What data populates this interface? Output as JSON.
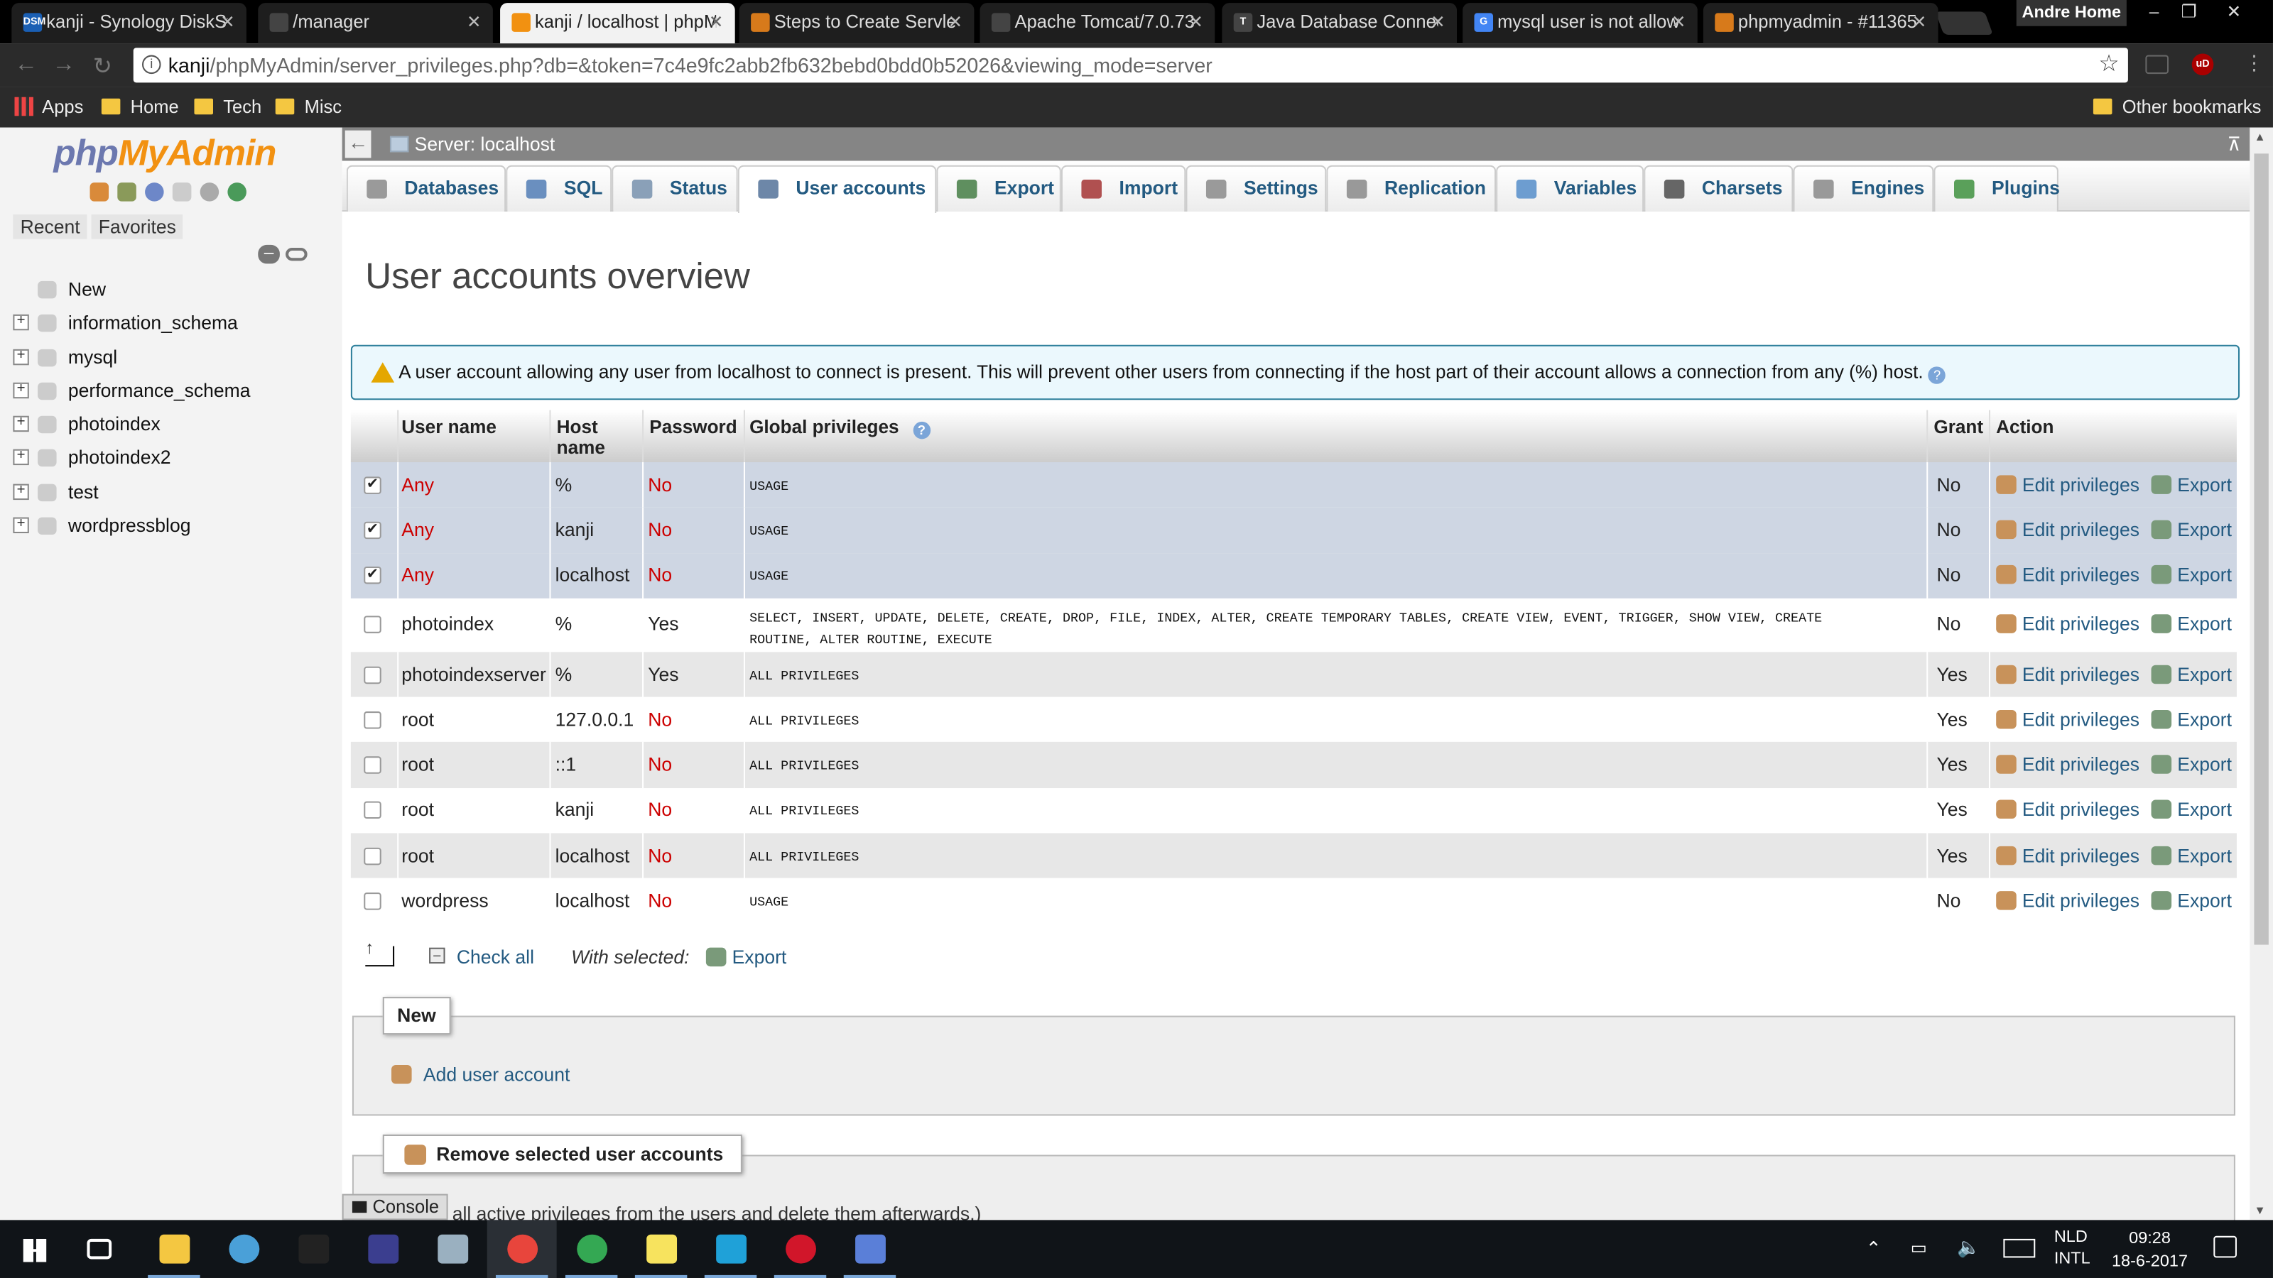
{
  "browser": {
    "tabs": [
      {
        "title": "kanji - Synology DiskStation",
        "favicon_text": "DSM",
        "favicon_color": "#1a5fb4"
      },
      {
        "title": "/manager",
        "favicon_text": "",
        "favicon_color": "#444"
      },
      {
        "title": "kanji / localhost | phpMyAdmin",
        "favicon_text": "",
        "favicon_color": "#f29111"
      },
      {
        "title": "Steps to Create Servlet",
        "favicon_text": "",
        "favicon_color": "#d77a1b"
      },
      {
        "title": "Apache Tomcat/7.0.73",
        "favicon_text": "",
        "favicon_color": "#444"
      },
      {
        "title": "Java Database Connectivity",
        "favicon_text": "T",
        "favicon_color": "#444"
      },
      {
        "title": "mysql user is not allowed",
        "favicon_text": "G",
        "favicon_color": "#4285f4"
      },
      {
        "title": "phpmyadmin - #11365",
        "favicon_text": "",
        "favicon_color": "#d77a1b"
      }
    ],
    "user_name": "Andre Home",
    "url_host": "kanji",
    "url_path": "/phpMyAdmin/server_privileges.php?db=&token=7c4e9fc2abb2fb632bebd0bdd0b52026&viewing_mode=server",
    "bookmarks": [
      "Apps",
      "Home",
      "Tech",
      "Misc"
    ],
    "other_bookmarks": "Other bookmarks"
  },
  "sidebar": {
    "logo_php": "php",
    "logo_myadmin": "MyAdmin",
    "tabs": [
      "Recent",
      "Favorites"
    ],
    "new_label": "New",
    "databases": [
      "information_schema",
      "mysql",
      "performance_schema",
      "photoindex",
      "photoindex2",
      "test",
      "wordpressblog"
    ]
  },
  "server_bar": {
    "label": "Server: localhost"
  },
  "menu": [
    {
      "label": "Databases",
      "icon": "database-icon",
      "icon_color": "#9a9a9a"
    },
    {
      "label": "SQL",
      "icon": "sql-icon",
      "icon_color": "#6a8fbf"
    },
    {
      "label": "Status",
      "icon": "status-icon",
      "icon_color": "#8aa0b8"
    },
    {
      "label": "User accounts",
      "icon": "users-icon",
      "icon_color": "#6d87a8"
    },
    {
      "label": "Export",
      "icon": "export-icon",
      "icon_color": "#5f8f5f"
    },
    {
      "label": "Import",
      "icon": "import-icon",
      "icon_color": "#b05050"
    },
    {
      "label": "Settings",
      "icon": "settings-icon",
      "icon_color": "#9a9a9a"
    },
    {
      "label": "Replication",
      "icon": "replication-icon",
      "icon_color": "#999"
    },
    {
      "label": "Variables",
      "icon": "variables-icon",
      "icon_color": "#6d9dd0"
    },
    {
      "label": "Charsets",
      "icon": "charsets-icon",
      "icon_color": "#666"
    },
    {
      "label": "Engines",
      "icon": "engines-icon",
      "icon_color": "#999"
    },
    {
      "label": "Plugins",
      "icon": "plugins-icon",
      "icon_color": "#5aa05a"
    }
  ],
  "page": {
    "title": "User accounts overview",
    "notice": "A user account allowing any user from localhost to connect is present. This will prevent other users from connecting if the host part of their account allows a connection from any (%) host."
  },
  "table": {
    "headers": {
      "user": "User name",
      "host1": "Host",
      "host2": "name",
      "password": "Password",
      "privileges": "Global privileges",
      "grant": "Grant",
      "action": "Action"
    },
    "edit_label": "Edit privileges",
    "export_label": "Export",
    "rows": [
      {
        "checked": true,
        "user": "Any",
        "host": "%",
        "password": "No",
        "privileges": "USAGE",
        "privileges2": "",
        "grant": "No"
      },
      {
        "checked": true,
        "user": "Any",
        "host": "kanji",
        "password": "No",
        "privileges": "USAGE",
        "privileges2": "",
        "grant": "No"
      },
      {
        "checked": true,
        "user": "Any",
        "host": "localhost",
        "password": "No",
        "privileges": "USAGE",
        "privileges2": "",
        "grant": "No"
      },
      {
        "checked": false,
        "user": "photoindex",
        "host": "%",
        "password": "Yes",
        "privileges": "SELECT, INSERT, UPDATE, DELETE, CREATE, DROP, FILE, INDEX, ALTER, CREATE TEMPORARY TABLES, CREATE VIEW, EVENT, TRIGGER, SHOW VIEW, CREATE",
        "privileges2": "ROUTINE, ALTER ROUTINE, EXECUTE",
        "grant": "No"
      },
      {
        "checked": false,
        "user": "photoindexserver",
        "host": "%",
        "password": "Yes",
        "privileges": "ALL PRIVILEGES",
        "privileges2": "",
        "grant": "Yes"
      },
      {
        "checked": false,
        "user": "root",
        "host": "127.0.0.1",
        "password": "No",
        "privileges": "ALL PRIVILEGES",
        "privileges2": "",
        "grant": "Yes"
      },
      {
        "checked": false,
        "user": "root",
        "host": "::1",
        "password": "No",
        "privileges": "ALL PRIVILEGES",
        "privileges2": "",
        "grant": "Yes"
      },
      {
        "checked": false,
        "user": "root",
        "host": "kanji",
        "password": "No",
        "privileges": "ALL PRIVILEGES",
        "privileges2": "",
        "grant": "Yes"
      },
      {
        "checked": false,
        "user": "root",
        "host": "localhost",
        "password": "No",
        "privileges": "ALL PRIVILEGES",
        "privileges2": "",
        "grant": "Yes"
      },
      {
        "checked": false,
        "user": "wordpress",
        "host": "localhost",
        "password": "No",
        "privileges": "USAGE",
        "privileges2": "",
        "grant": "No"
      }
    ]
  },
  "bulk": {
    "check_all": "Check all",
    "with_selected": "With selected:",
    "export": "Export"
  },
  "new_section": {
    "legend": "New",
    "add_user": "Add user account"
  },
  "remove_section": {
    "legend": "Remove selected user accounts",
    "description": "all active privileges from the users and delete them afterwards.)"
  },
  "console_label": "Console",
  "taskbar": {
    "apps": [
      {
        "name": "task-view-icon",
        "color": "#ffffff"
      },
      {
        "name": "file-explorer-icon",
        "color": "#f4c741"
      },
      {
        "name": "globe-icon",
        "color": "#4aa0d8"
      },
      {
        "name": "terminal-icon",
        "color": "#222222"
      },
      {
        "name": "eclipse-icon",
        "color": "#3b3e8f"
      },
      {
        "name": "turtle-icon",
        "color": "#9ab0c0"
      },
      {
        "name": "chrome-icon",
        "color": "#e8453c"
      },
      {
        "name": "chrome-icon-2",
        "color": "#34a853"
      },
      {
        "name": "sticky-notes-icon",
        "color": "#f7e35e"
      },
      {
        "name": "webstorm-icon",
        "color": "#1fa1d8"
      },
      {
        "name": "opera-icon",
        "color": "#d1162a"
      },
      {
        "name": "network-icon",
        "color": "#5a7fd8"
      }
    ],
    "lang1": "NLD",
    "lang2": "INTL",
    "time": "09:28",
    "date": "18-6-2017"
  }
}
